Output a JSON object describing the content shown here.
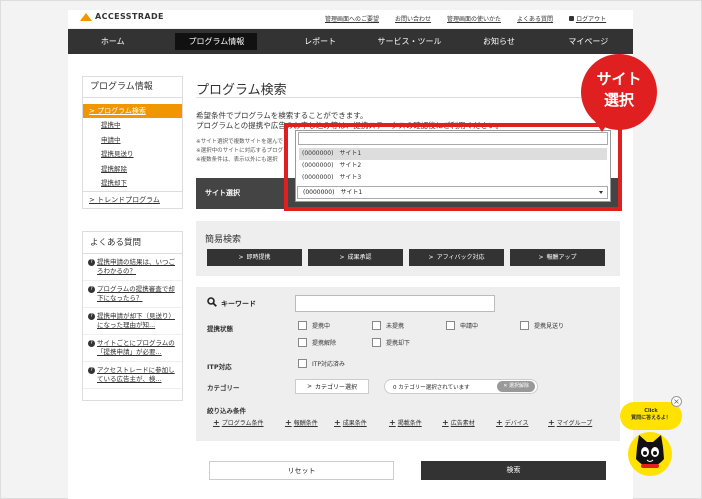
{
  "brand": {
    "name": "ACCESSTRADE",
    "color": "#f29600"
  },
  "toplinks": [
    "管理画面へのご要望",
    "お問い合わせ",
    "管理画面の使いかた",
    "よくある質問",
    "ログアウト"
  ],
  "gnav": [
    "ホーム",
    "プログラム情報",
    "レポート",
    "サービス・ツール",
    "お知らせ",
    "マイページ"
  ],
  "sidebar": {
    "title": "プログラム情報",
    "active": "プログラム検索",
    "subitems": [
      "提携中",
      "申請中",
      "提携見送り",
      "提携解除",
      "提携却下"
    ],
    "trend": "トレンドプログラム"
  },
  "faq": {
    "title": "よくある質問",
    "items": [
      "提携申請の結果は、いつごろわかるの？",
      "プログラムの提携審査で却下になったら？",
      "提携申請が却下（見送り）になった理由が知...",
      "サイトごとにプログラムの「提携申請」が必要...",
      "アクセストレードに参加している広告主が、検..."
    ]
  },
  "main": {
    "title": "プログラム検索",
    "desc1": "希望条件でプログラムを検索することができます。",
    "desc2": "プログラムとの提携や広告のお申し込み等は、提携ステータスの確認後にご利用ください。",
    "notes": [
      "※サイト選択で複数サイトを選んで",
      "※選択中のサイトに対応するプログ",
      "※複数条件は、表示以外にも選択"
    ],
    "site_label": "サイト選択",
    "simple_title": "簡易検索",
    "quick_buttons": [
      "即時提携",
      "成果承認",
      "アフィバック対応",
      "報酬アップ"
    ],
    "keyword_label": "キーワード",
    "status_label": "提携状態",
    "status_options": [
      "提携中",
      "未提携",
      "申請中",
      "提携見送り",
      "提携解除",
      "提携却下"
    ],
    "itp_label": "ITP対応",
    "itp_option": "ITP対応済み",
    "category_label": "カテゴリー",
    "category_button": "カテゴリー選択",
    "category_status": "0 カテゴリー選択されています",
    "category_clear": "選択解除",
    "narrow_label": "絞り込み条件",
    "narrow_items": [
      "プログラム条件",
      "報酬条件",
      "成果条件",
      "掲載条件",
      "広告素材",
      "デバイス",
      "マイグループ"
    ],
    "reset_label": "リセット",
    "search_label": "検索"
  },
  "dropdown": {
    "options": [
      "(0000000)　サイト1",
      "(0000000)　サイト2",
      "(0000000)　サイト3"
    ],
    "highlighted": 0,
    "selected": "(0000000)　サイト1"
  },
  "callout": {
    "line1": "サイト",
    "line2": "選択",
    "color": "#e02020"
  },
  "mascot": {
    "line1": "Click",
    "line2": "質問に答えるよ！"
  }
}
